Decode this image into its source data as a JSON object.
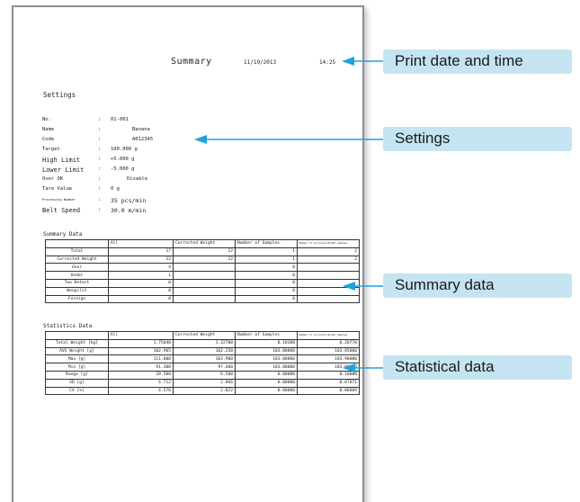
{
  "report": {
    "title": "Summary",
    "date": "11/19/2013",
    "time": "14:25",
    "settings_title": "Settings",
    "settings": [
      {
        "label": "No.",
        "sep": ":",
        "value": "01-001"
      },
      {
        "label": "Name",
        "sep": ":",
        "value": "Banana"
      },
      {
        "label": "Code",
        "sep": ":",
        "value": "A012345"
      },
      {
        "label": "Target",
        "sep": ":",
        "value": "100.000 g"
      },
      {
        "label": "High Limit",
        "sep": ":",
        "value": "+5.000 g"
      },
      {
        "label": "Lower Limit",
        "sep": ":",
        "value": "-5.000 g"
      },
      {
        "label": "Over OK",
        "sep": ":",
        "value": "Disable"
      },
      {
        "label": "Tare Value",
        "sep": ":",
        "value": "0 g"
      },
      {
        "label": "Processing Number",
        "sep": ":",
        "value": "35 pcs/min"
      },
      {
        "label": "Belt Speed",
        "sep": ":",
        "value": "30.0 m/min"
      }
    ],
    "summary_title": "Summary Data",
    "summary_headers": [
      "",
      "All",
      "Corrected Weight",
      "Number of Samples",
      "Number of Corrected Weight Samples"
    ],
    "summary_rows": [
      [
        "Total",
        "17",
        "12",
        "1",
        "2"
      ],
      [
        "Corrected Weight",
        "12",
        "12",
        "1",
        "2"
      ],
      [
        "Over",
        "4",
        "",
        "0",
        ""
      ],
      [
        "Under",
        "1",
        "",
        "0",
        ""
      ],
      [
        "Two Detect",
        "0",
        "",
        "0",
        ""
      ],
      [
        "Weupilit",
        "0",
        "",
        "0",
        ""
      ],
      [
        "Foreign",
        "0",
        "",
        "0",
        ""
      ]
    ],
    "stats_title": "Statistics Data",
    "stats_headers": [
      "",
      "All",
      "Corrected Weight",
      "Number of Samples",
      "Number of Corrected Weight Samples"
    ],
    "stats_rows": [
      [
        "Total Weight [kg]",
        "1.75040",
        "1.22700",
        "0.10380",
        "0.20770"
      ],
      [
        "AVG Weight [g]",
        "102.965",
        "102.250",
        "103.80000",
        "103.85000"
      ],
      [
        "Max [g]",
        "111.800",
        "103.900",
        "103.80000",
        "103.90000"
      ],
      [
        "Min [g]",
        "91.300",
        "97.400",
        "103.80000",
        "103.80000"
      ],
      [
        "Range [g]",
        "20.500",
        "6.500",
        "0.00000",
        "0.10000"
      ],
      [
        "SD [g]",
        "4.712",
        "2.866",
        "0.00000",
        "0.07071"
      ],
      [
        "CV [%]",
        "4.576",
        "2.822",
        "0.00000",
        "0.06809"
      ]
    ]
  },
  "callouts": {
    "print_date_time": "Print date and time",
    "settings": "Settings",
    "summary_data": "Summary data",
    "statistical_data": "Statistical data"
  },
  "colors": {
    "callout_bg": "#c4e4f2",
    "arrow": "#1fa2dc",
    "paper_border": "#8a8f99"
  }
}
